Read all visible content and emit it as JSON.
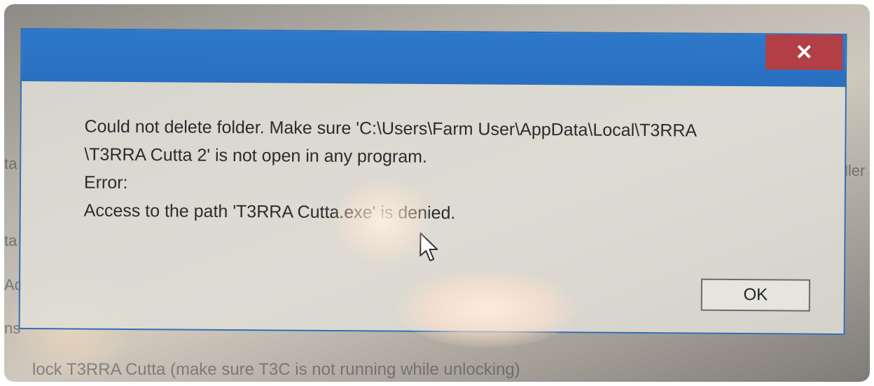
{
  "background": {
    "left_fragments": [
      "ta",
      "ta",
      "Ad",
      "ns"
    ],
    "right_fragment": "ller",
    "bottom_text": "lock T3RRA Cutta (make sure T3C is not running while unlocking)"
  },
  "dialog": {
    "close_symbol": "✕",
    "message": {
      "line1": "Could not delete folder. Make sure 'C:\\Users\\Farm User\\AppData\\Local\\T3RRA",
      "line2": "\\T3RRA Cutta 2' is not open in any program.",
      "line3": "Error:",
      "line4": "Access to the path 'T3RRA Cutta.exe' is denied."
    },
    "ok_label": "OK"
  },
  "colors": {
    "titlebar": "#2e78c9",
    "close_button": "#b23f45"
  },
  "icons": {
    "close": "close-icon",
    "cursor": "mouse-cursor-icon"
  }
}
